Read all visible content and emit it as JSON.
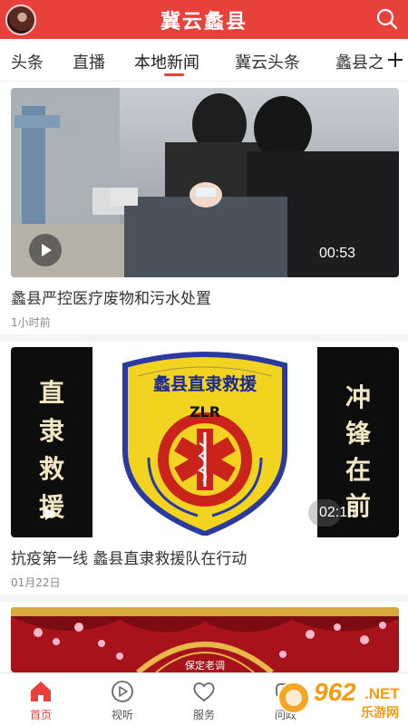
{
  "header": {
    "title": "冀云蠡县",
    "accent": "#e8403a"
  },
  "tabs": [
    {
      "label": "头条"
    },
    {
      "label": "直播"
    },
    {
      "label": "本地新闻",
      "active": true
    },
    {
      "label": "冀云头条"
    },
    {
      "label": "蠡县之"
    }
  ],
  "feed": [
    {
      "title": "蠡县严控医疗废物和污水处置",
      "meta": "1小时前",
      "duration": "00:53"
    },
    {
      "title": "抗疫第一线 蠡县直隶救援队在行动",
      "meta": "01月22日",
      "duration": "02:16",
      "banner_left": "直隶救援",
      "banner_right": "冲锋在前",
      "badge_top": "蠡县直隶救援",
      "badge_code": "ZLR"
    },
    {
      "caption": "保定老调"
    }
  ],
  "bottom_nav": [
    {
      "label": "首页",
      "icon": "home-icon",
      "active": true
    },
    {
      "label": "视听",
      "icon": "play-circle-icon"
    },
    {
      "label": "服务",
      "icon": "heart-icon"
    },
    {
      "label": "问政",
      "icon": "chat-icon"
    }
  ],
  "watermark": {
    "brand": "962",
    "domain": ".NET",
    "tagline": "乐游网"
  }
}
